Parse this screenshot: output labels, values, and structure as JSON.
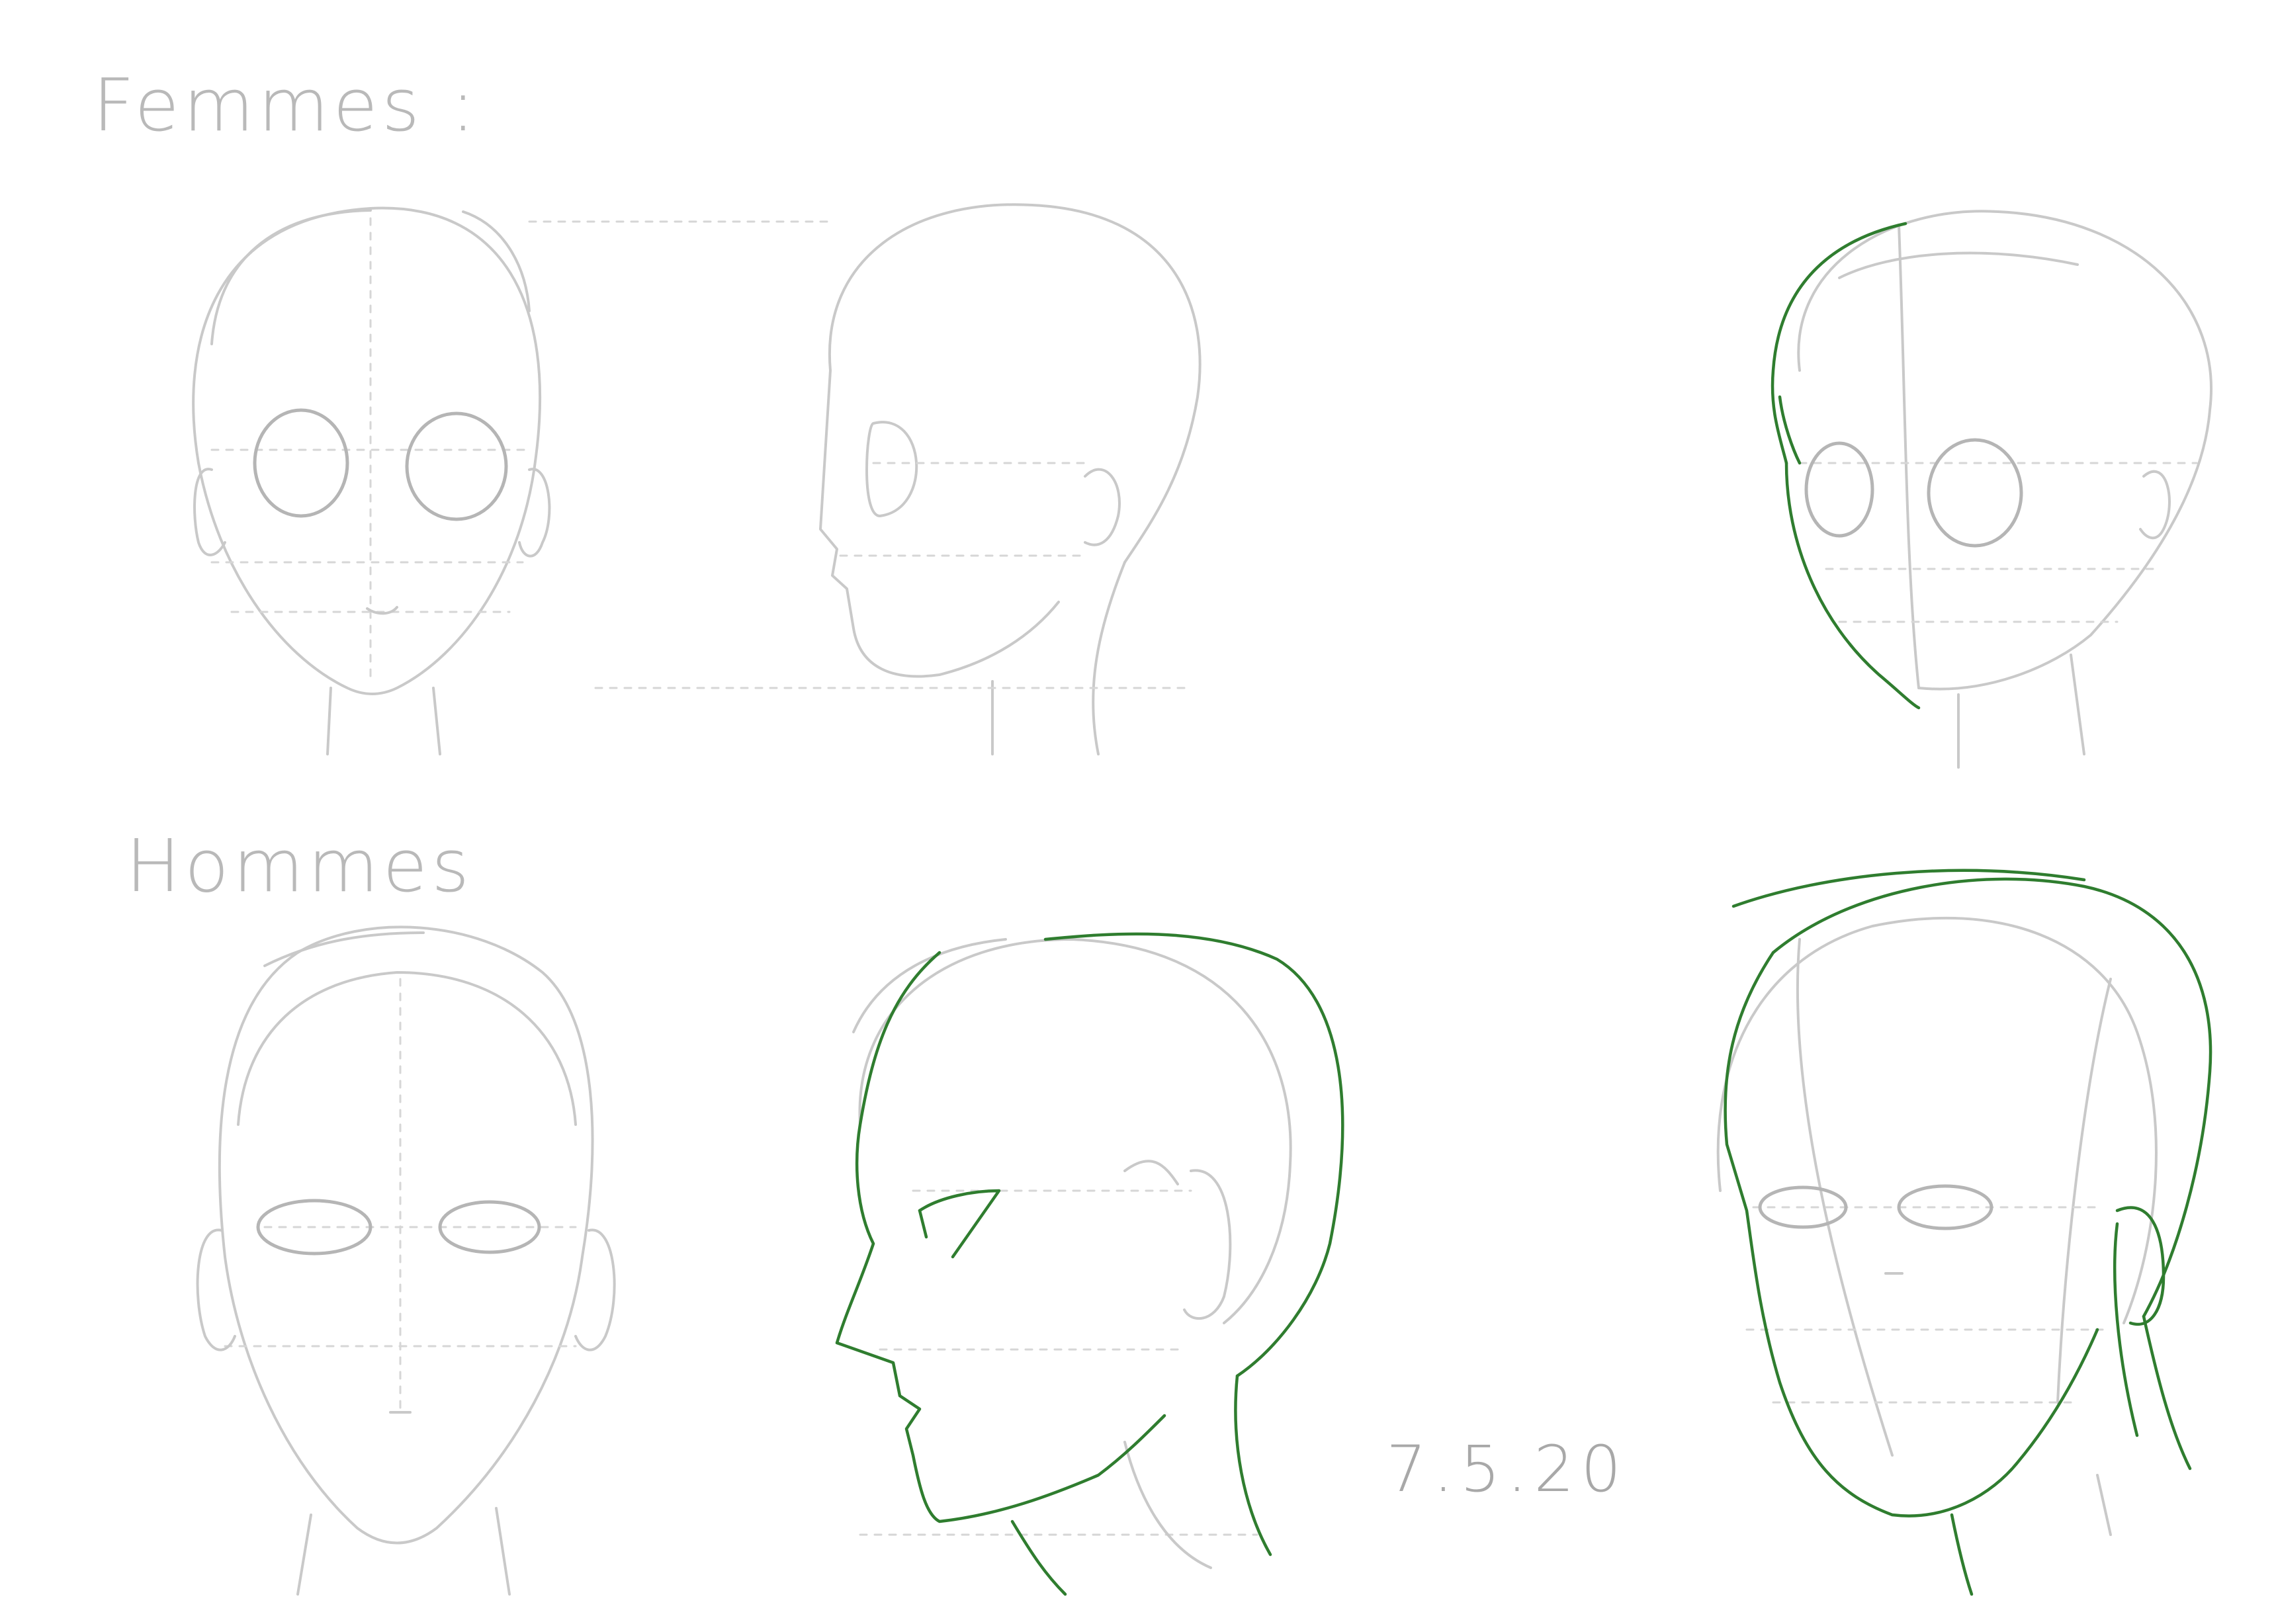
{
  "labels": {
    "women": "Femmes :",
    "men": "Hommes",
    "date": "7.5.20"
  },
  "colors": {
    "paper": "#ffffff",
    "pencil": "#c9c9c9",
    "ink": "#2f7d2f"
  },
  "drawings": [
    {
      "row": "women",
      "view": "front",
      "inked": false
    },
    {
      "row": "women",
      "view": "profile",
      "inked": false
    },
    {
      "row": "women",
      "view": "three-quarter",
      "inked": true
    },
    {
      "row": "men",
      "view": "front",
      "inked": false
    },
    {
      "row": "men",
      "view": "profile",
      "inked": true
    },
    {
      "row": "men",
      "view": "three-quarter",
      "inked": true
    }
  ]
}
